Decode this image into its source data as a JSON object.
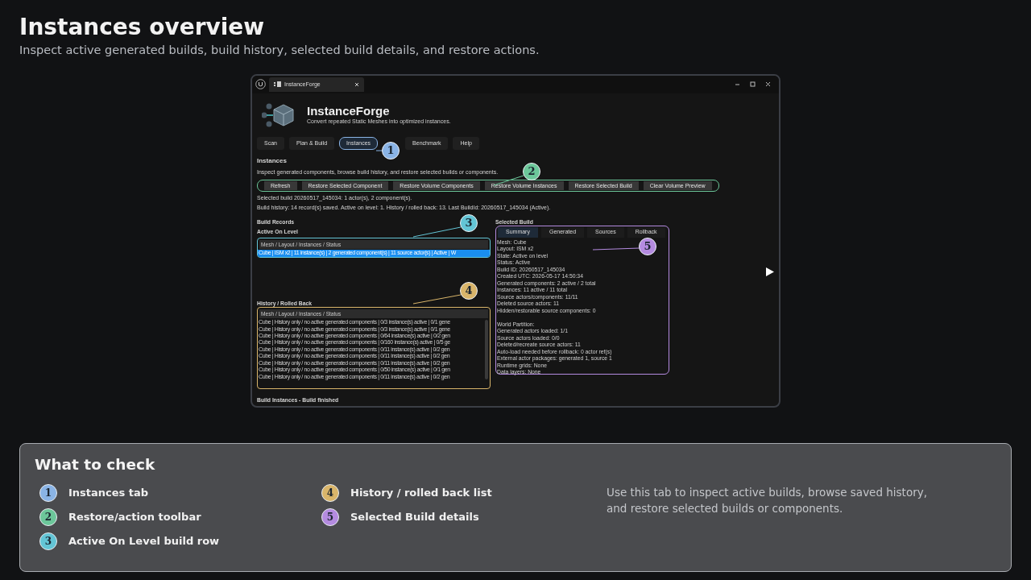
{
  "page": {
    "title": "Instances overview",
    "subtitle": "Inspect active generated builds, build history, selected build details, and restore actions."
  },
  "window": {
    "tab_title": "InstanceForge",
    "app_name": "InstanceForge",
    "app_tagline": "Convert repeated Static Meshes into optimized instances.",
    "tabs": [
      {
        "label": "Scan",
        "selected": false
      },
      {
        "label": "Plan & Build",
        "selected": false
      },
      {
        "label": "Instances",
        "selected": true
      },
      {
        "label": "Benchmark",
        "selected": false
      },
      {
        "label": "Help",
        "selected": false
      }
    ],
    "section_title": "Instances",
    "section_description": "Inspect generated components, browse build history, and restore selected builds or components.",
    "toolbar": [
      "Refresh",
      "Restore Selected Component",
      "Restore Volume Components",
      "Restore Volume Instances",
      "Restore Selected Build",
      "Clear Volume Preview"
    ],
    "status_lines": [
      "Selected build 20260517_145034: 1 actor(s), 2 component(s).",
      "Build history: 14 record(s) saved. Active on level: 1. History / rolled back: 13. Last BuildId: 20260517_145034 (Active)."
    ],
    "build_records_title": "Build Records",
    "active": {
      "title": "Active On Level",
      "header": "Mesh / Layout / Instances / Status",
      "rows": [
        {
          "text": "Cube | ISM x2 | 11 instance(s) | 2 generated component(s) | 11 source actor(s) | Active | W",
          "selected": true
        }
      ]
    },
    "history": {
      "title": "History / Rolled Back",
      "header": "Mesh / Layout / Instances / Status",
      "rows": [
        {
          "text": "Cube | History only / no active generated components | 0/3 instance(s) active | 0/1 gene",
          "selected": false
        },
        {
          "text": "Cube | History only / no active generated components | 0/3 instance(s) active | 0/1 gene",
          "selected": false
        },
        {
          "text": "Cube | History only / no active generated components | 0/64 instance(s) active | 0/2 gen",
          "selected": false
        },
        {
          "text": "Cube | History only / no active generated components | 0/160 instance(s) active | 0/5 ge",
          "selected": false
        },
        {
          "text": "Cube | History only / no active generated components | 0/11 instance(s) active | 0/2 gen",
          "selected": false
        },
        {
          "text": "Cube | History only / no active generated components | 0/11 instance(s) active | 0/2 gen",
          "selected": false
        },
        {
          "text": "Cube | History only / no active generated components | 0/11 instance(s) active | 0/2 gen",
          "selected": false
        },
        {
          "text": "Cube | History only / no active generated components | 0/50 instance(s) active | 0/1 gen",
          "selected": false
        },
        {
          "text": "Cube | History only / no active generated components | 0/11 instance(s) active | 0/2 gen",
          "selected": false
        }
      ]
    },
    "selected_build": {
      "title": "Selected Build",
      "tabs": [
        {
          "label": "Summary",
          "selected": true
        },
        {
          "label": "Generated",
          "selected": false
        },
        {
          "label": "Sources",
          "selected": false
        },
        {
          "label": "Rollback",
          "selected": false
        }
      ],
      "groups": [
        [
          "Mesh: Cube",
          "Layout: ISM x2",
          "State: Active on level",
          "Status: Active",
          "Build ID: 20260517_145034",
          "Created UTC: 2026-05-17 14:50:34",
          "Generated components: 2 active / 2 total",
          "Instances: 11 active / 11 total",
          "Source actors/components: 11/11",
          "Deleted source actors: 11",
          "Hidden/restorable source components: 0"
        ],
        [
          "World Partition:",
          "Generated actors loaded: 1/1",
          "Source actors loaded: 0/0",
          "Deleted/recreate source actors: 11",
          "Auto-load needed before rollback: 0 actor ref(s)",
          "External actor packages: generated 1, source 1",
          "Runtime grids: None",
          "Data layers: None"
        ]
      ]
    },
    "footer": "Build Instances - Build finished"
  },
  "callouts": [
    {
      "number": "1",
      "color": "#8ab4e6"
    },
    {
      "number": "2",
      "color": "#6cc79a"
    },
    {
      "number": "3",
      "color": "#63c5d6"
    },
    {
      "number": "4",
      "color": "#d9b56a"
    },
    {
      "number": "5",
      "color": "#b48be0"
    }
  ],
  "checklist": {
    "title": "What to check",
    "items": [
      {
        "number": "1",
        "color": "#8ab4e6",
        "label": "Instances tab"
      },
      {
        "number": "2",
        "color": "#6cc79a",
        "label": "Restore/action toolbar"
      },
      {
        "number": "3",
        "color": "#63c5d6",
        "label": "Active On Level build row"
      },
      {
        "number": "4",
        "color": "#d9b56a",
        "label": "History / rolled back list"
      },
      {
        "number": "5",
        "color": "#b48be0",
        "label": "Selected Build details"
      }
    ],
    "note": "Use this tab to inspect active builds, browse saved history, and restore selected builds or components."
  }
}
